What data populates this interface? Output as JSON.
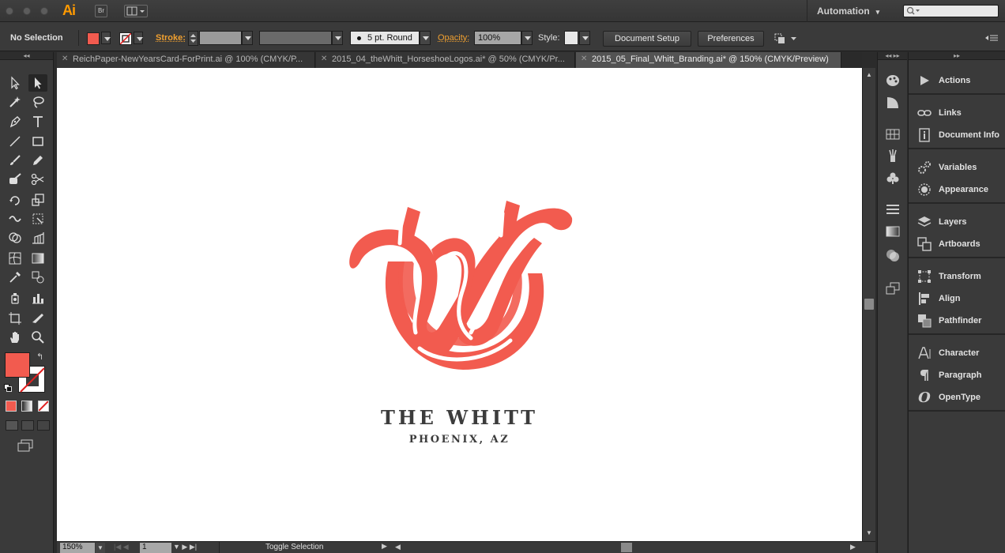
{
  "app": {
    "logo": "Ai",
    "bridge_label": "Br",
    "workspace": "Automation"
  },
  "control_bar": {
    "selection_status": "No Selection",
    "fill_color": "#f25b4f",
    "stroke_label": "Stroke:",
    "brush_value": "5 pt. Round",
    "opacity_label": "Opacity:",
    "opacity_value": "100%",
    "style_label": "Style:",
    "document_setup": "Document Setup",
    "preferences": "Preferences"
  },
  "tabs": [
    {
      "label": "ReichPaper-NewYearsCard-ForPrint.ai @ 100% (CMYK/P..."
    },
    {
      "label": "2015_04_theWhitt_HorseshoeLogos.ai* @ 50% (CMYK/Pr..."
    },
    {
      "label": "2015_05_Final_Whitt_Branding.ai* @ 150% (CMYK/Preview)"
    }
  ],
  "active_tab_index": 2,
  "artboard": {
    "brand_name": "THE WHITT",
    "location": "PHOENIX, AZ",
    "logo_color": "#f25b4f",
    "text_color": "#3c3c3c"
  },
  "status_bar": {
    "zoom": "150%",
    "artboard_number": "1",
    "status_text": "Toggle Selection"
  },
  "panels": [
    {
      "label": "Actions",
      "icon": "play-icon"
    },
    {
      "label": "Links",
      "icon": "link-icon"
    },
    {
      "label": "Document Info",
      "icon": "info-icon"
    },
    {
      "label": "Variables",
      "icon": "variables-icon"
    },
    {
      "label": "Appearance",
      "icon": "appearance-icon"
    },
    {
      "label": "Layers",
      "icon": "layers-icon"
    },
    {
      "label": "Artboards",
      "icon": "artboards-icon"
    },
    {
      "label": "Transform",
      "icon": "transform-icon"
    },
    {
      "label": "Align",
      "icon": "align-icon"
    },
    {
      "label": "Pathfinder",
      "icon": "pathfinder-icon"
    },
    {
      "label": "Character",
      "icon": "character-icon"
    },
    {
      "label": "Paragraph",
      "icon": "paragraph-icon"
    },
    {
      "label": "OpenType",
      "icon": "opentype-icon"
    }
  ],
  "toolbox": {
    "fill_swatch": "#f25b4f",
    "stroke_swatch": "#ffffff"
  }
}
